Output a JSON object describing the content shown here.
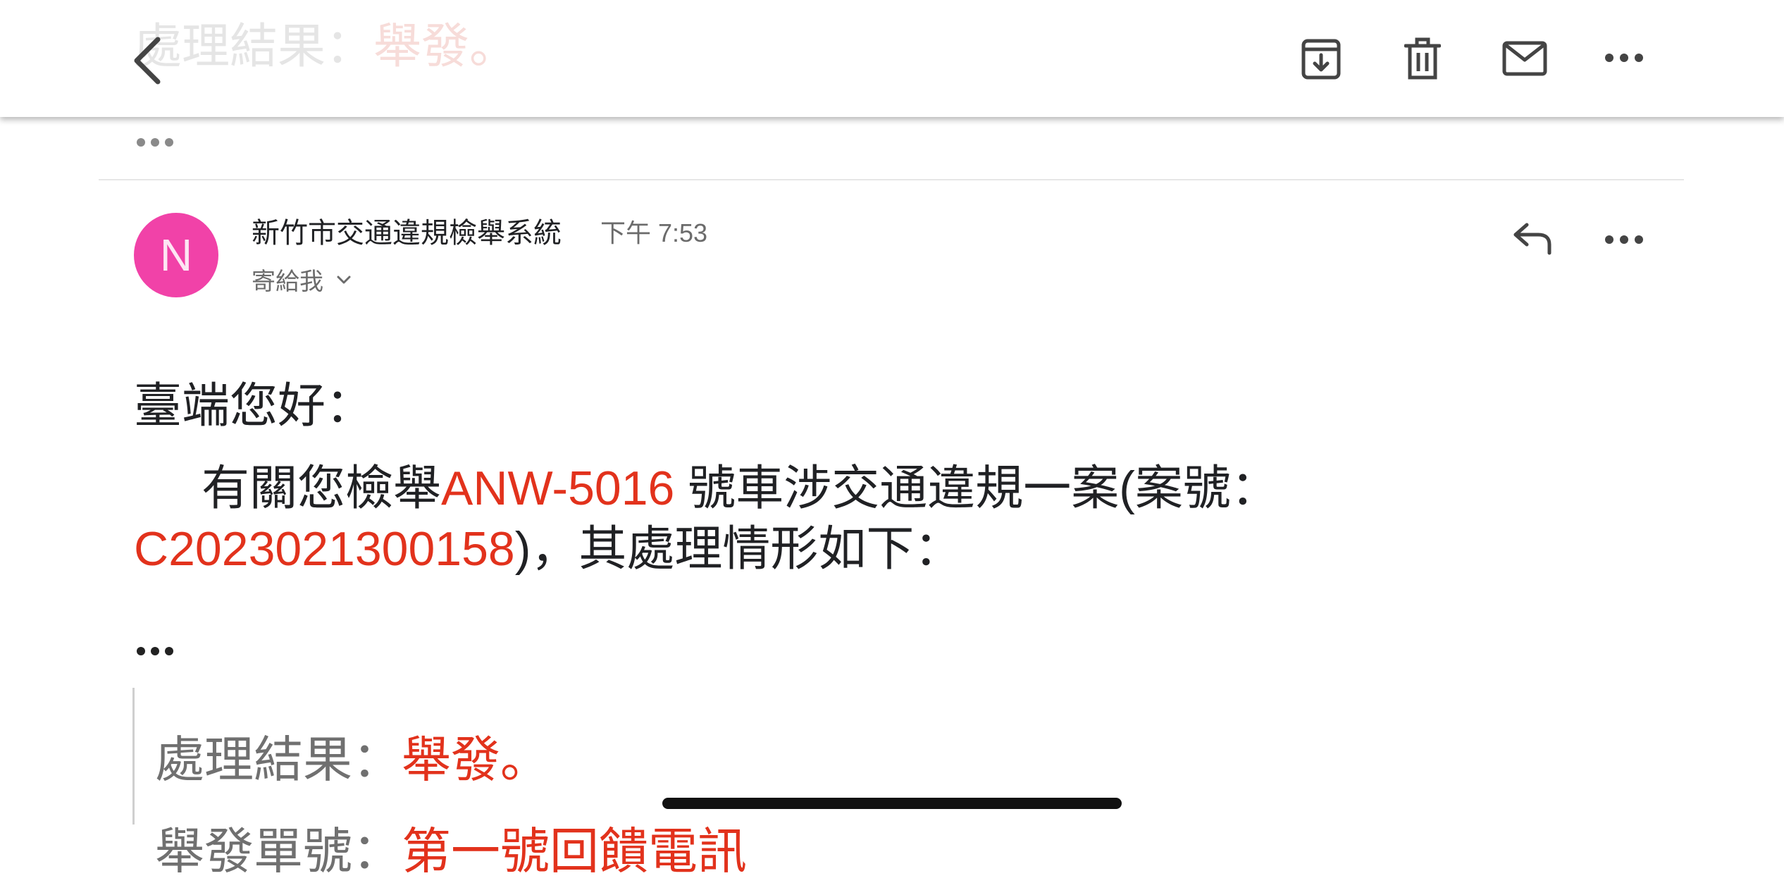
{
  "header": {
    "ghost_title_prefix": "處理結果：",
    "ghost_title_value": "舉發。",
    "back_icon": "chevron-left-icon",
    "archive_icon": "archive-icon",
    "delete_icon": "trash-icon",
    "mark_unread_icon": "mail-icon",
    "more_icon": "more-horizontal-icon"
  },
  "thread": {
    "collapsed_icon": "ellipsis-icon"
  },
  "message": {
    "avatar_letter": "N",
    "avatar_color": "#f142a8",
    "sender": "新竹市交通違規檢舉系統",
    "time": "下午 7:53",
    "recipient": "寄給我",
    "reply_icon": "reply-icon",
    "more_icon": "more-horizontal-icon"
  },
  "body": {
    "greeting": "臺端您好：",
    "para_part1": "有關您檢舉",
    "plate": "ANW-5016",
    "para_part2": " 號車涉交通違規一案(案號：",
    "case_number": "C2023021300158",
    "para_part3": ")，其處理情形如下：",
    "trimmed_icon": "ellipsis-icon",
    "result_label": "處理結果：",
    "result_value": "舉發。",
    "next_line_label": "舉發單號：",
    "next_line_value": "第一號回饋電訊"
  },
  "colors": {
    "accent_red": "#e2321c",
    "avatar_pink": "#f142a8"
  }
}
